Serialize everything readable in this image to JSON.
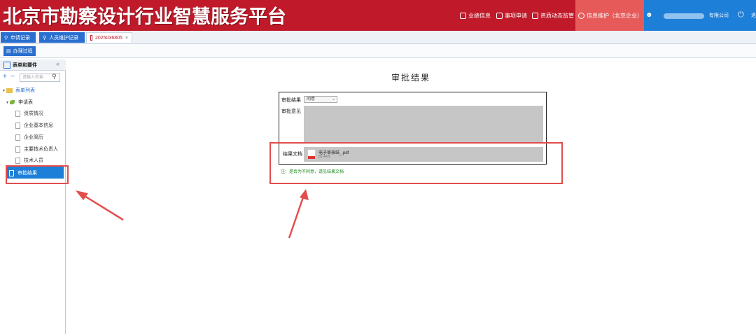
{
  "header": {
    "brand": "北京市勘察设计行业智慧服务平台",
    "nav": [
      {
        "label": "业绩信息",
        "icon": "eye-icon"
      },
      {
        "label": "事项申请",
        "icon": "edit-icon"
      },
      {
        "label": "资质动态监管",
        "icon": "monitor-icon"
      },
      {
        "label": "信息维护（北京企业）",
        "icon": "gear-icon"
      }
    ],
    "company_suffix": "有限公司",
    "logout_label": "退",
    "colors": {
      "bar": "#c0192a",
      "active": "#e65a5a",
      "user_zone": "#1e7fd8"
    }
  },
  "tabs": [
    {
      "label": "申请记录",
      "icon": "search-icon"
    },
    {
      "label": "人员维护记录",
      "icon": "person-search-icon"
    },
    {
      "label": "2025036805",
      "icon": "document-icon",
      "close": "×"
    }
  ],
  "toolbar": {
    "button_label": "办理过程"
  },
  "sidebar": {
    "title": "表单和要件",
    "collapse": "«",
    "search_placeholder": "请输入检索",
    "add": "+",
    "remove": "−",
    "search_icon": "🔍",
    "tree": {
      "root": "表单列表",
      "group": "申请表",
      "items": [
        "资质情况",
        "企业基本信息",
        "企业简历",
        "主要技术负责人",
        "技术人员",
        "审批结果"
      ],
      "selected": "审批结果"
    }
  },
  "main": {
    "title": "审批结果",
    "result_label": "审批结果",
    "result_value": "同意",
    "opinion_label": "审批意见",
    "file_label": "结果文档",
    "file_name": "电子审核结_.pdf",
    "file_size": "66.4KB",
    "note": "注：是否为不同意，请见结果文档"
  }
}
